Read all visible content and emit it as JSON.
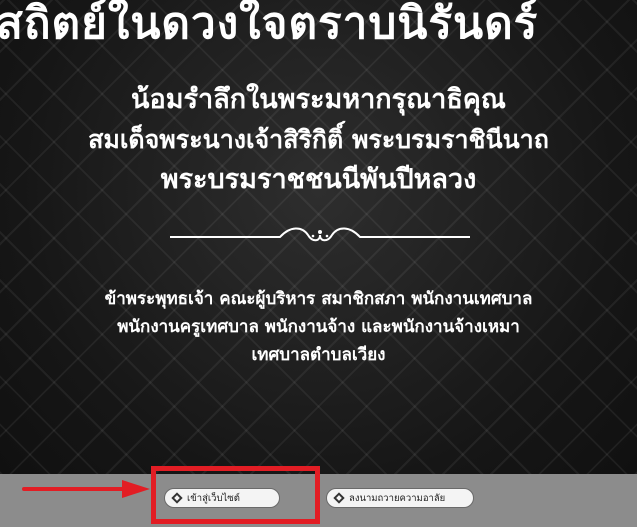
{
  "banner": {
    "top_title": "สถิตย์ในดวงใจตราบนิรันดร์",
    "heading_lines": [
      "น้อมรำลึกในพระมหากรุณาธิคุณ",
      "สมเด็จพระนางเจ้าสิริกิติ์ พระบรมราชินีนาถ",
      "พระบรมราชชนนีพันปีหลวง"
    ],
    "body_lines": [
      "ข้าพระพุทธเจ้า คณะผู้บริหาร สมาชิกสภา พนักงานเทศบาล",
      "พนักงานครูเทศบาล พนักงานจ้าง และพนักงานจ้างเหมา",
      "เทศบาลตำบลเวียง"
    ]
  },
  "buttons": {
    "enter_site_label": "เข้าสู่เว็บไซต์",
    "sign_condolence_label": "ลงนามถวายความอาลัย"
  },
  "colors": {
    "banner_bg": "#1c1c1c",
    "bottom_bar": "#8c8c8c",
    "highlight": "#e21d24"
  },
  "icons": {
    "button_icon": "diamond-icon",
    "pointer": "red-arrow-icon"
  }
}
